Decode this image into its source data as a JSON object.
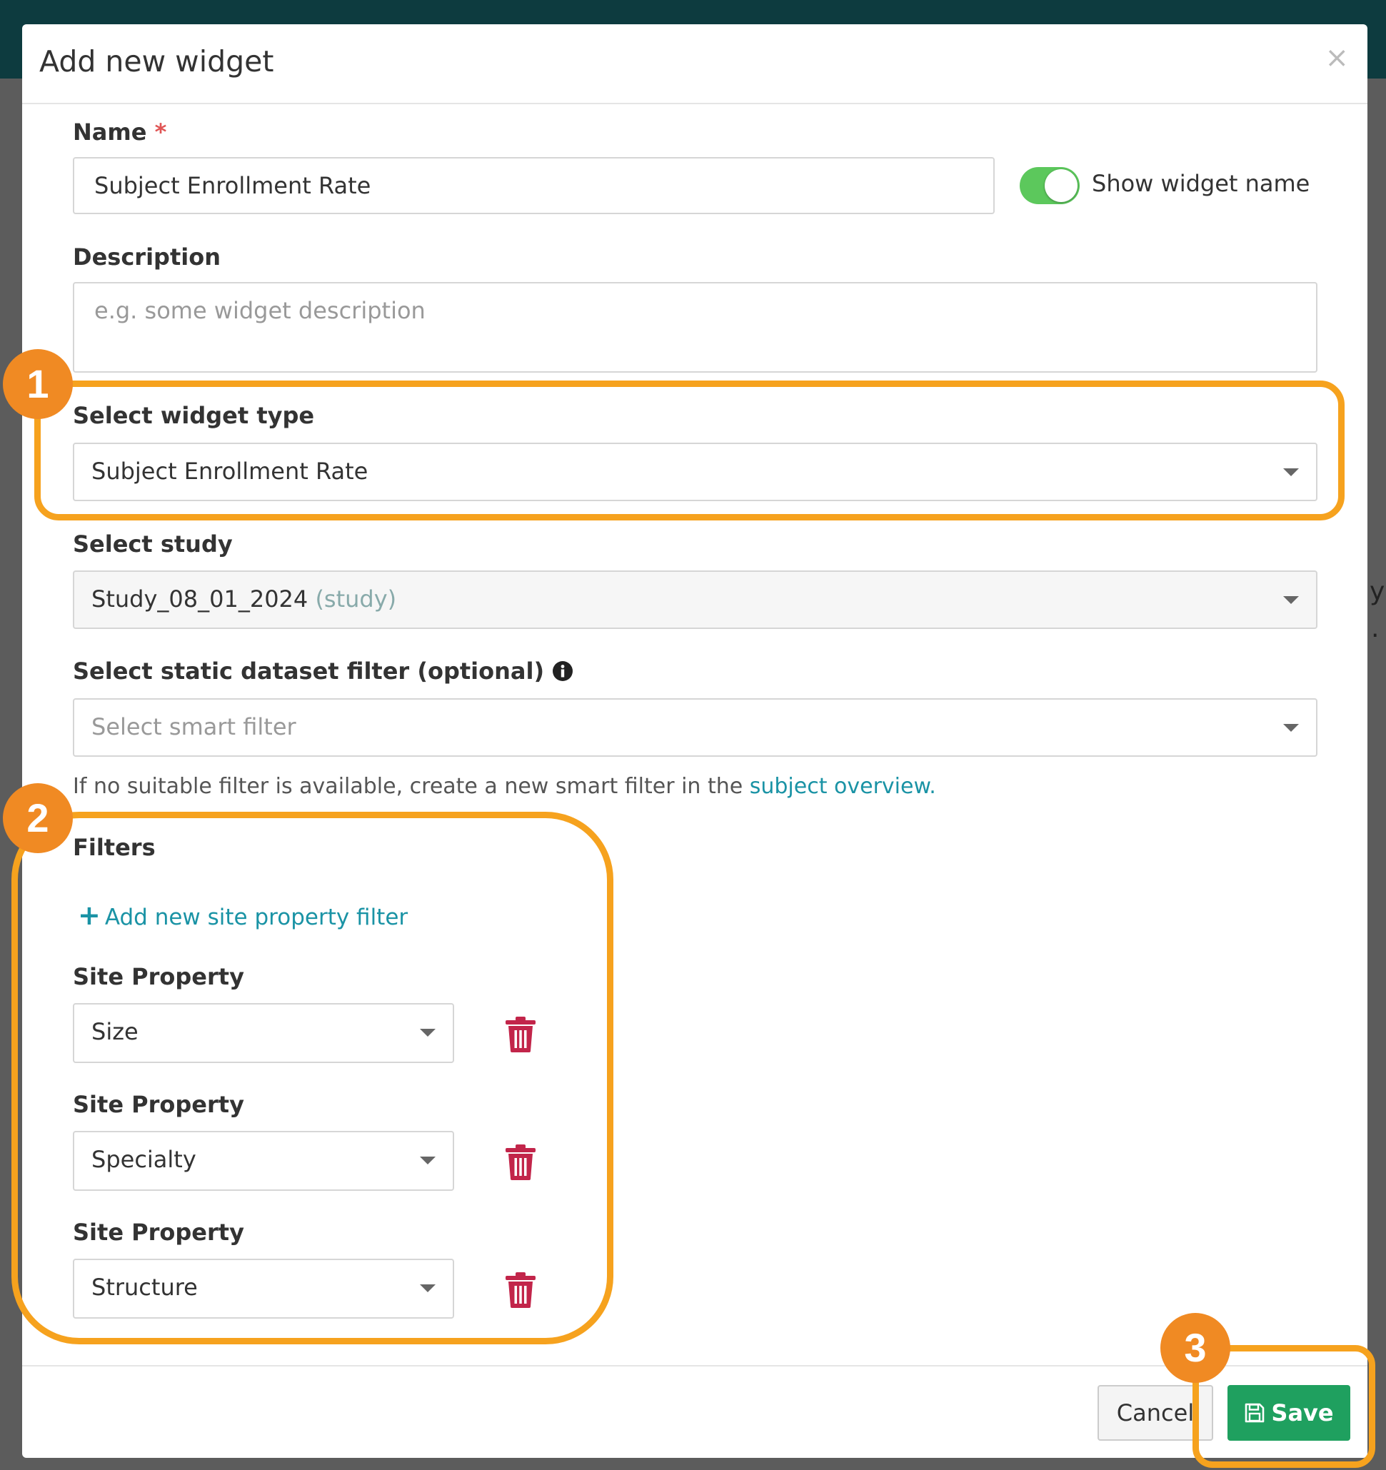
{
  "modal": {
    "title": "Add new widget",
    "close": "×"
  },
  "background": {
    "partial_text": "y",
    "dot": "."
  },
  "name": {
    "label": "Name",
    "required": "*",
    "value": "Subject Enrollment Rate",
    "show_name_label": "Show widget name",
    "show_name_on": true
  },
  "description": {
    "label": "Description",
    "placeholder": "e.g. some widget description"
  },
  "widget_type": {
    "label": "Select widget type",
    "value": "Subject Enrollment Rate"
  },
  "study": {
    "label": "Select study",
    "value": "Study_08_01_2024",
    "suffix": "(study)"
  },
  "static_filter": {
    "label": "Select static dataset filter (optional)",
    "placeholder": "Select smart filter",
    "hint_prefix": "If no suitable filter is available, create a new smart filter in the",
    "hint_link": "subject overview."
  },
  "filters": {
    "label": "Filters",
    "add_plus": "+",
    "add_label": "Add new site property filter",
    "items": [
      {
        "label": "Site Property",
        "value": "Size"
      },
      {
        "label": "Site Property",
        "value": "Specialty"
      },
      {
        "label": "Site Property",
        "value": "Structure"
      }
    ]
  },
  "footer": {
    "cancel": "Cancel",
    "save": "Save"
  },
  "callouts": [
    "1",
    "2",
    "3"
  ],
  "colors": {
    "highlight": "#f6a21e",
    "badge": "#f08a23",
    "link": "#1a93a5",
    "save": "#1fa05f",
    "trash": "#c2254a",
    "toggle": "#5cc85c"
  }
}
